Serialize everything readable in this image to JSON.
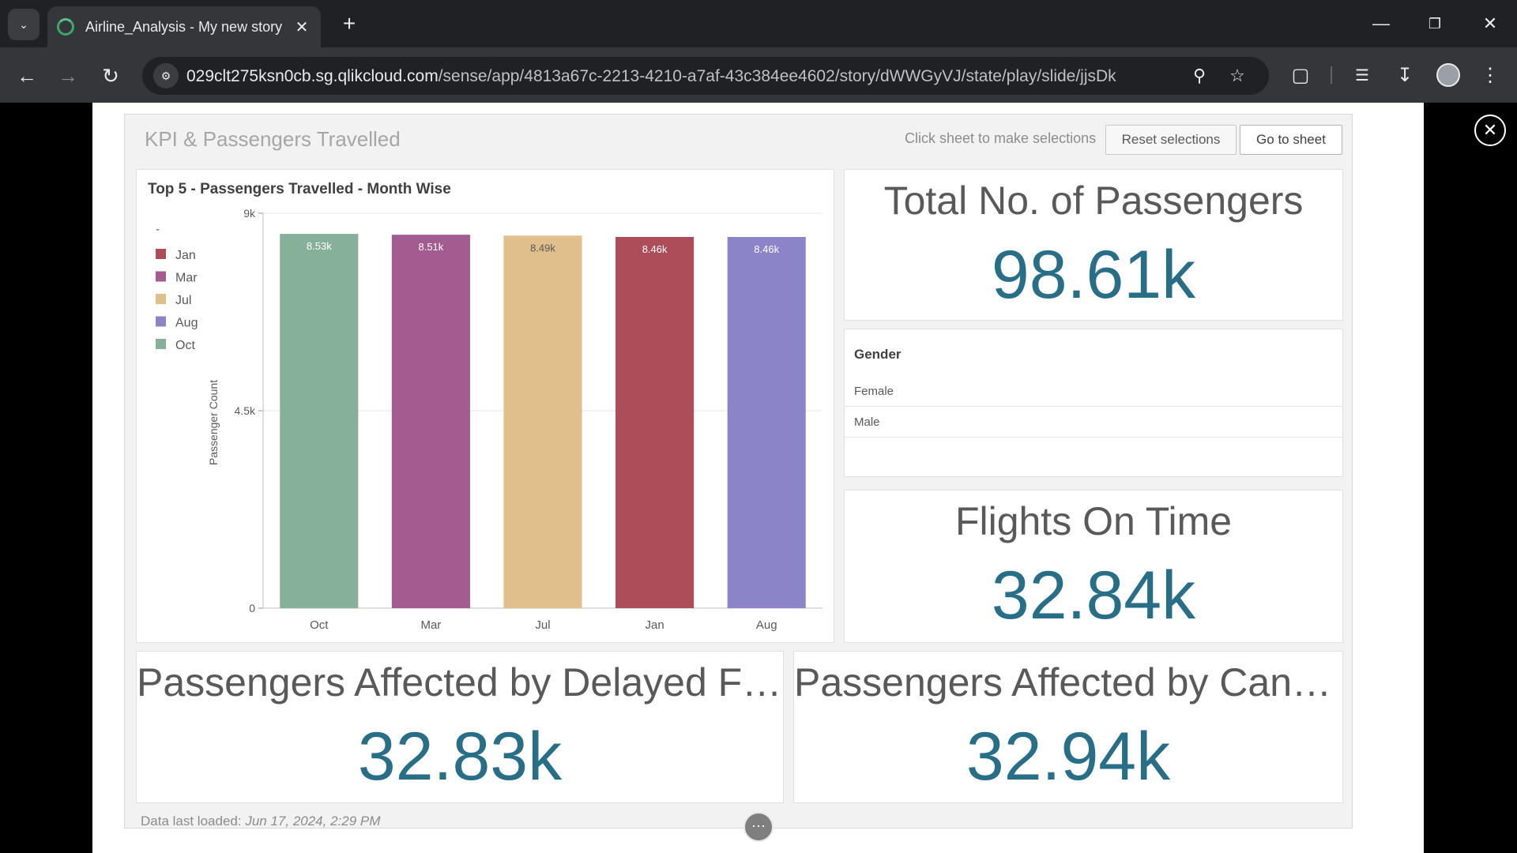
{
  "browser": {
    "tab_title": "Airline_Analysis - My new story",
    "url_host": "029clt275ksn0cb.sg.qlikcloud.com",
    "url_path": "/sense/app/4813a67c-2213-4210-a7af-43c384ee4602/story/dWWGyVJ/state/play/slide/jjsDk"
  },
  "sheet": {
    "title": "KPI & Passengers Travelled",
    "hint": "Click sheet to make selections",
    "reset_label": "Reset selections",
    "goto_label": "Go to sheet",
    "data_loaded_prefix": "Data last loaded:",
    "data_loaded_time": "Jun 17, 2024, 2:29 PM"
  },
  "kpis": {
    "total_passengers": {
      "label": "Total No. of Passengers",
      "value": "98.61k"
    },
    "flights_on_time": {
      "label": "Flights On Time",
      "value": "32.84k"
    },
    "delayed": {
      "label": "Passengers Affected by Delayed Fli…",
      "value": "32.83k"
    },
    "cancelled": {
      "label": "Passengers Affected by Cance…",
      "value": "32.94k"
    }
  },
  "gender_filter": {
    "title": "Gender",
    "options": [
      "Female",
      "Male"
    ]
  },
  "chart_data": {
    "type": "bar",
    "title": "Top 5 - Passengers Travelled - Month Wise",
    "xlabel": "",
    "ylabel": "Passenger Count",
    "categories": [
      "Oct",
      "Mar",
      "Jul",
      "Jan",
      "Aug"
    ],
    "values": [
      8530,
      8510,
      8490,
      8460,
      8460
    ],
    "data_labels": [
      "8.53k",
      "8.51k",
      "8.49k",
      "8.46k",
      "8.46k"
    ],
    "colors": [
      "#87b09b",
      "#a35c8f",
      "#e1bf8d",
      "#ad4d5a",
      "#8c84c8"
    ],
    "ylim": [
      0,
      9000
    ],
    "yticks": [
      0,
      4500,
      9000
    ],
    "ytick_labels": [
      "0",
      "4.5k",
      "9k"
    ],
    "grid": true,
    "legend": {
      "position": "top-left",
      "title": "-",
      "entries": [
        {
          "label": "Jan",
          "color": "#ad4d5a"
        },
        {
          "label": "Mar",
          "color": "#a35c8f"
        },
        {
          "label": "Jul",
          "color": "#e1bf8d"
        },
        {
          "label": "Aug",
          "color": "#8c84c8"
        },
        {
          "label": "Oct",
          "color": "#87b09b"
        }
      ]
    }
  }
}
